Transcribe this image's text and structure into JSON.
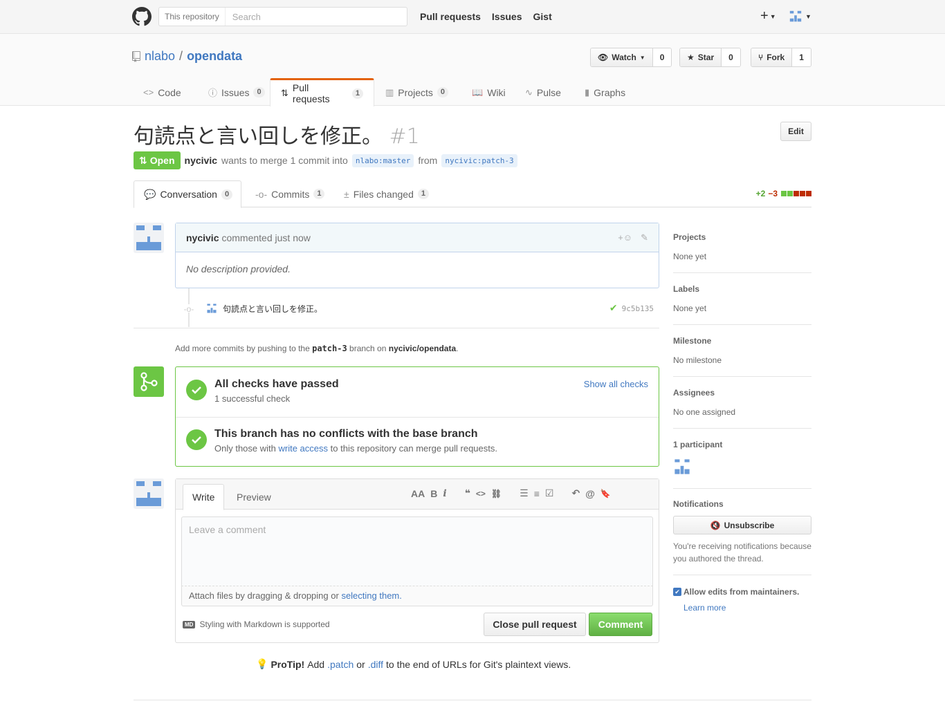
{
  "header": {
    "search_scope": "This repository",
    "search_placeholder": "Search",
    "nav": [
      "Pull requests",
      "Issues",
      "Gist"
    ],
    "plus": "+"
  },
  "repo": {
    "owner": "nlabo",
    "separator": "/",
    "name": "opendata",
    "watch_label": "Watch",
    "watch_count": "0",
    "star_label": "Star",
    "star_count": "0",
    "fork_label": "Fork",
    "fork_count": "1",
    "tabs": [
      {
        "label": "Code",
        "counter": ""
      },
      {
        "label": "Issues",
        "counter": "0"
      },
      {
        "label": "Pull requests",
        "counter": "1"
      },
      {
        "label": "Projects",
        "counter": "0"
      },
      {
        "label": "Wiki",
        "counter": ""
      },
      {
        "label": "Pulse",
        "counter": ""
      },
      {
        "label": "Graphs",
        "counter": ""
      }
    ]
  },
  "pr": {
    "title": "句読点と言い回しを修正。",
    "number": "#1",
    "edit_label": "Edit",
    "state": "Open",
    "author": "nycivic",
    "merge_text": "wants to merge 1 commit into",
    "base_branch": "nlabo:master",
    "from_text": "from",
    "head_branch": "nycivic:patch-3",
    "tabs": [
      {
        "label": "Conversation",
        "counter": "0"
      },
      {
        "label": "Commits",
        "counter": "1"
      },
      {
        "label": "Files changed",
        "counter": "1"
      }
    ],
    "additions": "+2",
    "deletions": "−3"
  },
  "comment": {
    "author": "nycivic",
    "meta": "commented just now",
    "reaction": "+☺",
    "body": "No description provided."
  },
  "commit": {
    "message": "句読点と言い回しを修正。",
    "sha": "9c5b135"
  },
  "add_more": {
    "prefix": "Add more commits by pushing to the",
    "branch": "patch-3",
    "middle": "branch on",
    "repo": "nycivic/opendata",
    "suffix": "."
  },
  "merge": {
    "checks_title": "All checks have passed",
    "checks_sub": "1 successful check",
    "show_checks": "Show all checks",
    "conflict_title": "This branch has no conflicts with the base branch",
    "conflict_sub_prefix": "Only those with",
    "conflict_link": "write access",
    "conflict_sub_suffix": "to this repository can merge pull requests."
  },
  "new_comment": {
    "tab_write": "Write",
    "tab_preview": "Preview",
    "placeholder": "Leave a comment",
    "attach_prefix": "Attach files by dragging & dropping or",
    "attach_link": "selecting them.",
    "markdown_note": "Styling with Markdown is supported",
    "markdown_badge": "MD",
    "close_label": "Close pull request",
    "comment_label": "Comment",
    "toolbar": [
      "AA",
      "B",
      "i",
      "❝",
      "<>",
      "⛓",
      "☰",
      "≡",
      "☑",
      "↶",
      "@",
      "🔖"
    ]
  },
  "protip": {
    "label": "ProTip!",
    "prefix": "Add",
    "patch": ".patch",
    "or": "or",
    "diff": ".diff",
    "suffix": "to the end of URLs for Git's plaintext views."
  },
  "sidebar": {
    "projects_label": "Projects",
    "projects_value": "None yet",
    "labels_label": "Labels",
    "labels_value": "None yet",
    "milestone_label": "Milestone",
    "milestone_value": "No milestone",
    "assignees_label": "Assignees",
    "assignees_value": "No one assigned",
    "participants_label": "1 participant",
    "notifications_label": "Notifications",
    "unsubscribe_label": "Unsubscribe",
    "notif_reason": "You're receiving notifications because you authored the thread.",
    "allow_edits": "Allow edits from maintainers.",
    "learn_more": "Learn more"
  },
  "colors": {
    "accent": "#4078c0",
    "success": "#6cc644",
    "danger": "#bd2c00",
    "selected_tab": "#e36209"
  }
}
